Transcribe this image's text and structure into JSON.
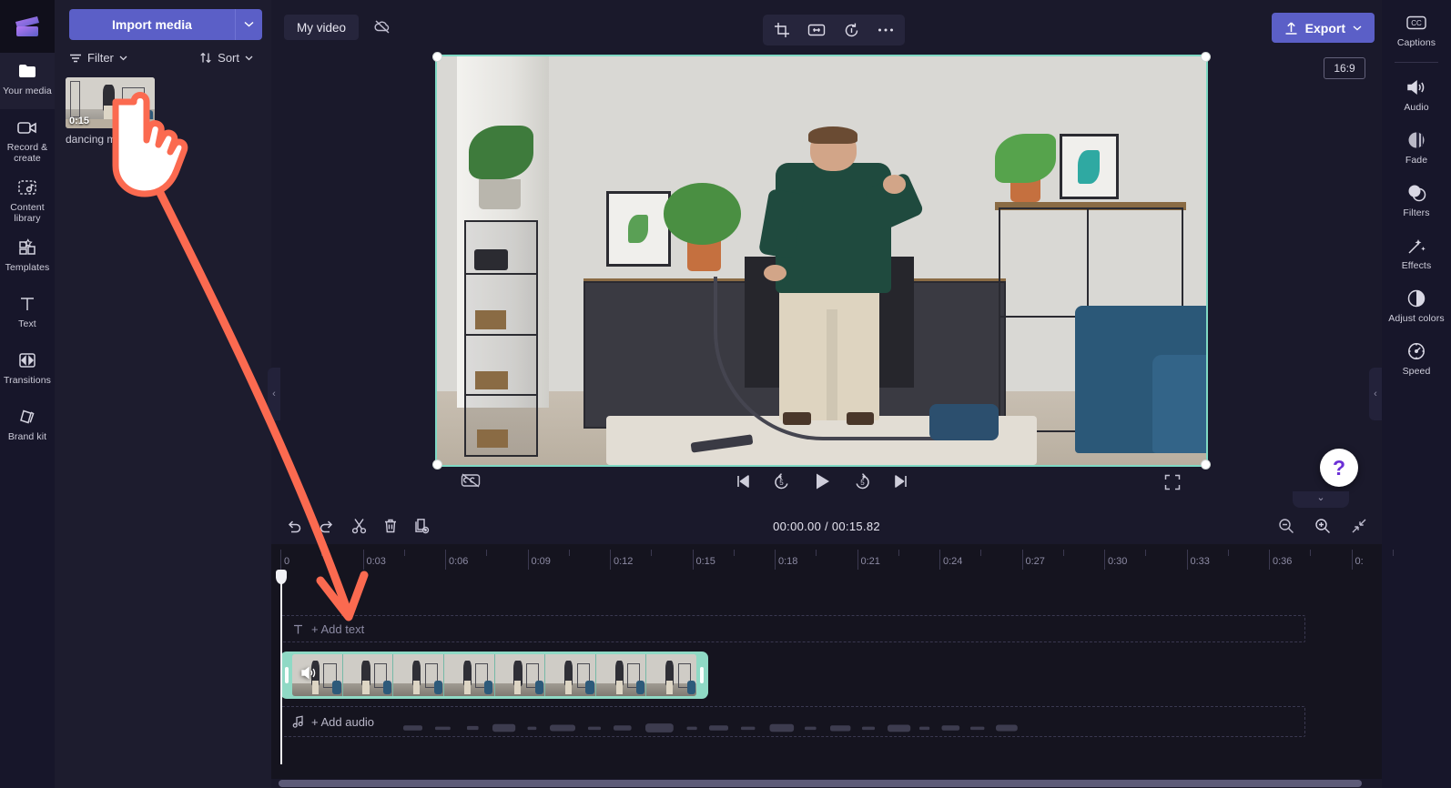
{
  "app": {
    "logo_icon": "clipchamp-logo-icon",
    "accent_color": "#5b5fc7",
    "selection_color": "#8fd9c5",
    "annotation_color": "#fb6a50"
  },
  "left_rail": {
    "items": [
      {
        "label": "Your media",
        "icon": "folder-icon",
        "active": true
      },
      {
        "label": "Record & create",
        "icon": "video-camera-icon",
        "active": false
      },
      {
        "label": "Content library",
        "icon": "content-library-icon",
        "active": false
      },
      {
        "label": "Templates",
        "icon": "templates-icon",
        "active": false
      },
      {
        "label": "Text",
        "icon": "text-t-icon",
        "active": false
      },
      {
        "label": "Transitions",
        "icon": "transitions-icon",
        "active": false
      },
      {
        "label": "Brand kit",
        "icon": "brand-kit-icon",
        "active": false
      }
    ]
  },
  "media_panel": {
    "import_label": "Import media",
    "import_caret_icon": "chevron-down-icon",
    "filter_label": "Filter",
    "filter_icon": "filter-icon",
    "sort_label": "Sort",
    "sort_icon": "sort-arrows-icon",
    "items": [
      {
        "title": "dancing ma",
        "duration": "0:15"
      }
    ],
    "collapse_icon": "chevron-left-icon"
  },
  "stage": {
    "project_name": "My video",
    "autosave_icon": "cloud-off-icon",
    "tools": [
      {
        "name": "crop-icon"
      },
      {
        "name": "fit-to-frame-icon"
      },
      {
        "name": "rotate-icon"
      },
      {
        "name": "more-options-icon"
      }
    ],
    "export_label": "Export",
    "export_icon": "upload-icon",
    "export_caret_icon": "chevron-down-icon",
    "aspect_ratio": "16:9"
  },
  "playback": {
    "captions_toggle_icon": "captions-off-icon",
    "controls": [
      {
        "name": "skip-to-start-button",
        "icon": "skip-previous-icon"
      },
      {
        "name": "rewind-5-seconds-button",
        "icon": "replay-5-icon",
        "label": "5"
      },
      {
        "name": "play-button",
        "icon": "play-icon"
      },
      {
        "name": "forward-5-seconds-button",
        "icon": "forward-5-icon",
        "label": "5"
      },
      {
        "name": "skip-to-end-button",
        "icon": "skip-next-icon"
      }
    ],
    "fullscreen_icon": "fullscreen-icon"
  },
  "right_rail": {
    "items": [
      {
        "label": "Captions",
        "icon": "closed-captions-icon"
      },
      {
        "label": "Audio",
        "icon": "speaker-icon"
      },
      {
        "label": "Fade",
        "icon": "fade-icon"
      },
      {
        "label": "Filters",
        "icon": "filters-icon"
      },
      {
        "label": "Effects",
        "icon": "magic-wand-icon"
      },
      {
        "label": "Adjust colors",
        "icon": "contrast-circle-icon"
      },
      {
        "label": "Speed",
        "icon": "speedometer-icon"
      }
    ],
    "collapse_icon": "chevron-left-icon",
    "help_label": "?",
    "timeline_collapse_icon": "chevron-down-icon"
  },
  "timeline": {
    "tools": [
      {
        "name": "undo-button",
        "icon": "undo-icon"
      },
      {
        "name": "redo-button",
        "icon": "redo-icon"
      },
      {
        "name": "split-button",
        "icon": "scissors-icon"
      },
      {
        "name": "delete-button",
        "icon": "trash-icon"
      },
      {
        "name": "duplicate-button",
        "icon": "duplicate-icon"
      }
    ],
    "current_time": "00:00.00",
    "time_separator": " / ",
    "total_time": "00:15.82",
    "zoom_out_icon": "zoom-out-icon",
    "zoom_in_icon": "zoom-in-icon",
    "fit_icon": "fit-timeline-icon",
    "ruler_ticks": [
      "0",
      "0:03",
      "0:06",
      "0:09",
      "0:12",
      "0:15",
      "0:18",
      "0:21",
      "0:24",
      "0:27",
      "0:30",
      "0:33",
      "0:36",
      "0:"
    ],
    "text_track_label": "+ Add text",
    "text_track_icon": "text-t-icon",
    "audio_track_label": "+ Add audio",
    "audio_track_icon": "music-note-icon",
    "clip": {
      "audio_icon": "speaker-icon",
      "selected": true
    }
  },
  "annotation": {
    "cursor_icon": "pointing-hand-cursor",
    "arrow_color": "#fb6a50"
  }
}
